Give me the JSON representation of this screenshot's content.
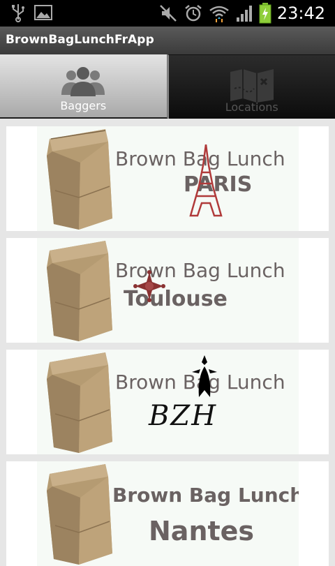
{
  "status_bar": {
    "time": "23:42",
    "left_icons": [
      "usb-icon",
      "image-icon"
    ],
    "right_icons": [
      "mute-icon",
      "alarm-icon",
      "wifi-icon",
      "signal-icon",
      "battery-charging-icon"
    ]
  },
  "app": {
    "title": "BrownBagLunchFrApp"
  },
  "tabs": [
    {
      "label": "Baggers",
      "icon": "people-icon",
      "active": true
    },
    {
      "label": "Locations",
      "icon": "map-icon",
      "active": false
    }
  ],
  "baggers": [
    {
      "line1": "Brown Bag Lunch",
      "line2": "PARIS"
    },
    {
      "line1": "Brown Bag Lunch",
      "line2": "Toulouse"
    },
    {
      "line1": "Brown Bag Lunch",
      "line2": "BZH"
    },
    {
      "line1": "Brown Bag Lunch",
      "line2": "Nantes"
    }
  ],
  "colors": {
    "bag": "#b59b72",
    "logo_text": "#6a6262",
    "title_bar": "#4a4a4a"
  }
}
